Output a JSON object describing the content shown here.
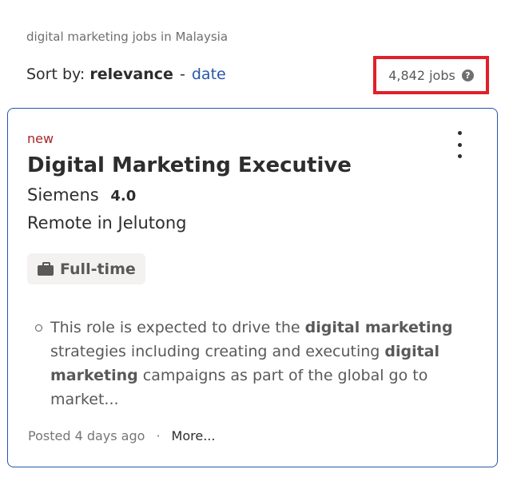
{
  "search": {
    "summary": "digital marketing jobs in Malaysia"
  },
  "sort": {
    "prefix": "Sort by:",
    "active": "relevance",
    "separator": "-",
    "alternate": "date"
  },
  "results": {
    "count": "4,842 jobs",
    "help_icon": "question-circle-icon"
  },
  "job": {
    "badge": "new",
    "title": "Digital Marketing Executive",
    "company": "Siemens",
    "rating": "4.0",
    "location": "Remote in Jelutong",
    "type": "Full-time",
    "type_icon": "briefcase-icon",
    "snippet": {
      "t1": "This role is expected to drive the ",
      "b1": "digital marketing",
      "t2": " strategies including creating and executing ",
      "b2": "digital marketing",
      "t3": " campaigns as part of the global go to market..."
    },
    "posted": "Posted 4 days ago",
    "dot": "·",
    "more_link": "More...",
    "menu_icon": "more-vertical-icon"
  },
  "colors": {
    "accent": "#2557a7",
    "badge": "#a9252b",
    "highlight_box": "#e0202a"
  }
}
